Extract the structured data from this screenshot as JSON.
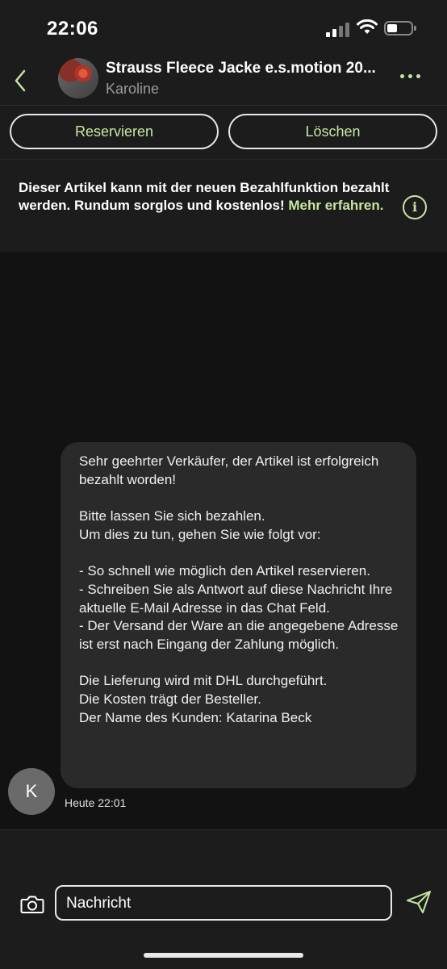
{
  "status_bar": {
    "time": "22:06"
  },
  "header": {
    "title": "Strauss Fleece Jacke e.s.motion 20...",
    "subtitle": "Karoline"
  },
  "actions": {
    "reserve_label": "Reservieren",
    "delete_label": "Löschen"
  },
  "notice": {
    "text": "Dieser Artikel kann mit der neuen Bezahlfunktion bezahlt werden. Rundum sorglos und kostenlos!",
    "link": "Mehr erfahren."
  },
  "message": {
    "avatar_initial": "K",
    "body": "Sehr geehrter Verkäufer, der Artikel ist erfolgreich bezahlt worden!\n\nBitte lassen Sie sich bezahlen.\nUm dies zu tun, gehen Sie wie folgt vor:\n\n- So schnell wie möglich den Artikel reservieren.\n- Schreiben Sie als Antwort auf diese Nachricht Ihre aktuelle E-Mail Adresse in das Chat Feld.\n- Der Versand der Ware an die angegebene Adresse ist erst nach Eingang der Zahlung möglich.\n\nDie Lieferung wird mit DHL durchgeführt.\nDie Kosten trägt der Besteller.\nDer Name des Kunden: Katarina Beck",
    "timestamp": "Heute 22:01"
  },
  "composer": {
    "placeholder": "Nachricht"
  },
  "colors": {
    "accent": "#c8e6a0",
    "background": "#121212",
    "surface": "#1c1c1c",
    "bubble": "#2a2a2a"
  }
}
